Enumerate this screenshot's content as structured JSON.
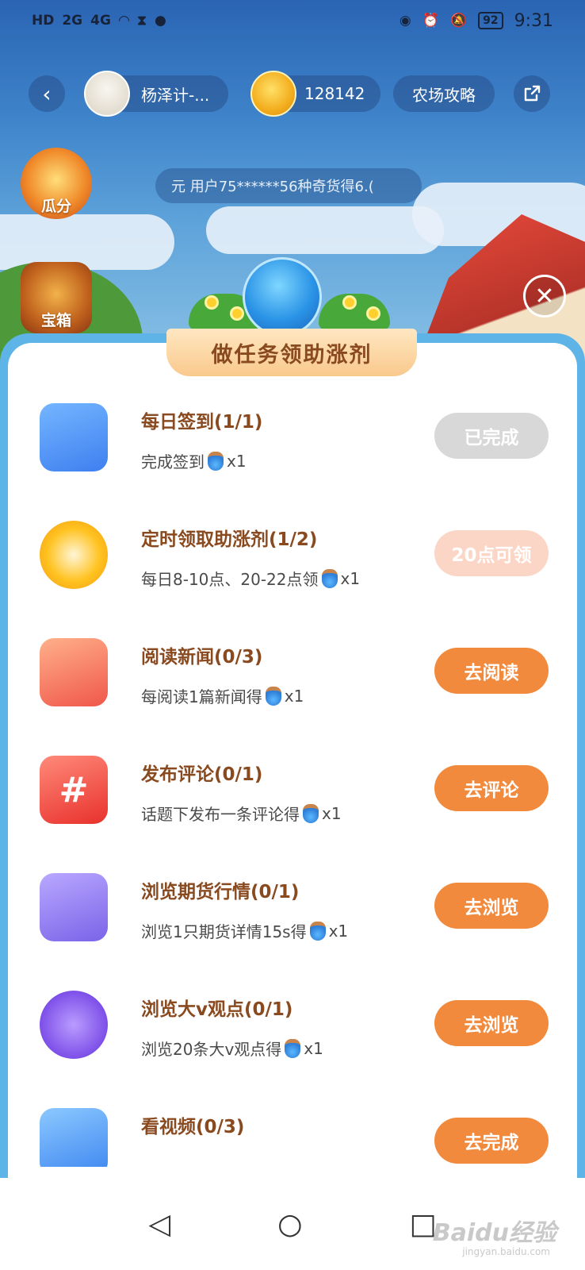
{
  "status_bar": {
    "left_icons": [
      "HD",
      "2G",
      "4G",
      "wifi-icon",
      "hourglass-icon",
      "wechat-icon"
    ],
    "battery": "92",
    "time": "9:31"
  },
  "top_bar": {
    "user_name": "杨泽计-...",
    "coins": "128142",
    "strategy_label": "农场攻略"
  },
  "side": {
    "guafen": "瓜分",
    "baoxiang": "宝箱"
  },
  "marquee": "元   用户75******56种奇货得6.(",
  "panel": {
    "title": "做任务领助涨剂",
    "tasks": [
      {
        "title": "每日签到(1/1)",
        "desc": "完成签到",
        "reward": "x1",
        "button": "已完成",
        "state": "done",
        "icon": "calendar-icon"
      },
      {
        "title": "定时领取助涨剂(1/2)",
        "desc": "每日8-10点、20-22点领",
        "reward": "x1",
        "button": "20点可领",
        "state": "wait",
        "icon": "alarm-clock-icon"
      },
      {
        "title": "阅读新闻(0/3)",
        "desc": "每阅读1篇新闻得",
        "reward": "x1",
        "button": "去阅读",
        "state": "go",
        "icon": "phone-news-icon"
      },
      {
        "title": "发布评论(0/1)",
        "desc": "话题下发布一条评论得",
        "reward": "x1",
        "button": "去评论",
        "state": "go",
        "icon": "hashtag-comment-icon"
      },
      {
        "title": "浏览期货行情(0/1)",
        "desc": "浏览1只期货详情15s得",
        "reward": "x1",
        "button": "去浏览",
        "state": "go",
        "icon": "chart-monitor-icon"
      },
      {
        "title": "浏览大v观点(0/1)",
        "desc": "浏览20条大v观点得",
        "reward": "x1",
        "button": "去浏览",
        "state": "go",
        "icon": "v-chat-icon"
      },
      {
        "title": "看视频(0/3)",
        "desc": "",
        "reward": "",
        "button": "去完成",
        "state": "go",
        "icon": "tv-play-icon"
      }
    ]
  },
  "colors": {
    "accent_orange": "#f18a3d",
    "title_brown": "#8a4a1f",
    "done_gray": "#d8d8d8",
    "wait_pink": "#fbd6c6",
    "panel_blue": "#5eb4e6"
  },
  "watermark": {
    "main": "Baidu经验",
    "sub": "jingyan.baidu.com"
  }
}
